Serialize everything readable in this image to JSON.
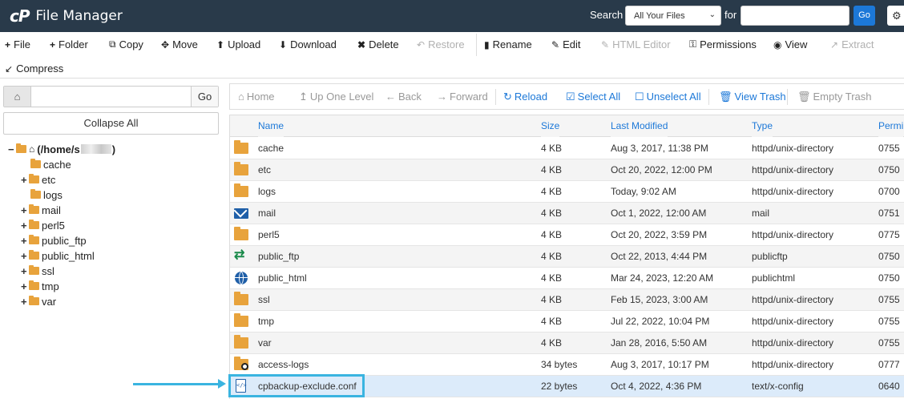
{
  "header": {
    "logo": "cP",
    "title": "File Manager",
    "search_label": "Search",
    "search_scope": "All Your Files",
    "for_label": "for",
    "search_value": "",
    "go_label": "Go"
  },
  "toolbar": {
    "file": "File",
    "folder": "Folder",
    "copy": "Copy",
    "move": "Move",
    "upload": "Upload",
    "download": "Download",
    "delete": "Delete",
    "restore": "Restore",
    "rename": "Rename",
    "edit": "Edit",
    "html_editor": "HTML Editor",
    "permissions": "Permissions",
    "view": "View",
    "extract": "Extract",
    "compress": "Compress"
  },
  "left": {
    "path_value": "",
    "go_label": "Go",
    "collapse_all": "Collapse All",
    "root_prefix": "(/home/s",
    "root_suffix": ")",
    "tree": [
      {
        "label": "cache",
        "toggle": ""
      },
      {
        "label": "etc",
        "toggle": "+"
      },
      {
        "label": "logs",
        "toggle": ""
      },
      {
        "label": "mail",
        "toggle": "+"
      },
      {
        "label": "perl5",
        "toggle": "+"
      },
      {
        "label": "public_ftp",
        "toggle": "+"
      },
      {
        "label": "public_html",
        "toggle": "+"
      },
      {
        "label": "ssl",
        "toggle": "+"
      },
      {
        "label": "tmp",
        "toggle": "+"
      },
      {
        "label": "var",
        "toggle": "+"
      }
    ]
  },
  "nav": {
    "home": "Home",
    "up_one_level": "Up One Level",
    "back": "Back",
    "forward": "Forward",
    "reload": "Reload",
    "select_all": "Select All",
    "unselect_all": "Unselect All",
    "view_trash": "View Trash",
    "empty_trash": "Empty Trash"
  },
  "table": {
    "columns": [
      "Name",
      "Size",
      "Last Modified",
      "Type",
      "Permi"
    ],
    "rows": [
      {
        "icon": "folder-icon",
        "name": "cache",
        "size": "4 KB",
        "modified": "Aug 3, 2017, 11:38 PM",
        "type": "httpd/unix-directory",
        "perm": "0755"
      },
      {
        "icon": "folder-icon",
        "name": "etc",
        "size": "4 KB",
        "modified": "Oct 20, 2022, 12:00 PM",
        "type": "httpd/unix-directory",
        "perm": "0750"
      },
      {
        "icon": "folder-icon",
        "name": "logs",
        "size": "4 KB",
        "modified": "Today, 9:02 AM",
        "type": "httpd/unix-directory",
        "perm": "0700"
      },
      {
        "icon": "mail-icon",
        "name": "mail",
        "size": "4 KB",
        "modified": "Oct 1, 2022, 12:00 AM",
        "type": "mail",
        "perm": "0751"
      },
      {
        "icon": "folder-icon",
        "name": "perl5",
        "size": "4 KB",
        "modified": "Oct 20, 2022, 3:59 PM",
        "type": "httpd/unix-directory",
        "perm": "0775"
      },
      {
        "icon": "transfer-icon",
        "name": "public_ftp",
        "size": "4 KB",
        "modified": "Oct 22, 2013, 4:44 PM",
        "type": "publicftp",
        "perm": "0750"
      },
      {
        "icon": "globe-icon",
        "name": "public_html",
        "size": "4 KB",
        "modified": "Mar 24, 2023, 12:20 AM",
        "type": "publichtml",
        "perm": "0750"
      },
      {
        "icon": "folder-icon",
        "name": "ssl",
        "size": "4 KB",
        "modified": "Feb 15, 2023, 3:00 AM",
        "type": "httpd/unix-directory",
        "perm": "0755"
      },
      {
        "icon": "folder-icon",
        "name": "tmp",
        "size": "4 KB",
        "modified": "Jul 22, 2022, 10:04 PM",
        "type": "httpd/unix-directory",
        "perm": "0755"
      },
      {
        "icon": "folder-icon",
        "name": "var",
        "size": "4 KB",
        "modified": "Jan 28, 2016, 5:50 AM",
        "type": "httpd/unix-directory",
        "perm": "0755"
      },
      {
        "icon": "symlink-folder-icon",
        "name": "access-logs",
        "size": "34 bytes",
        "modified": "Aug 3, 2017, 10:17 PM",
        "type": "httpd/unix-directory",
        "perm": "0777"
      },
      {
        "icon": "config-file-icon",
        "name": "cpbackup-exclude.conf",
        "size": "22 bytes",
        "modified": "Oct 4, 2022, 4:36 PM",
        "type": "text/x-config",
        "perm": "0640"
      }
    ]
  },
  "colors": {
    "header_bg": "#293a4a",
    "accent": "#1c78d8",
    "folder": "#e8a33c",
    "highlight": "#3ab4e0",
    "selected_row": "#dcebfa"
  }
}
